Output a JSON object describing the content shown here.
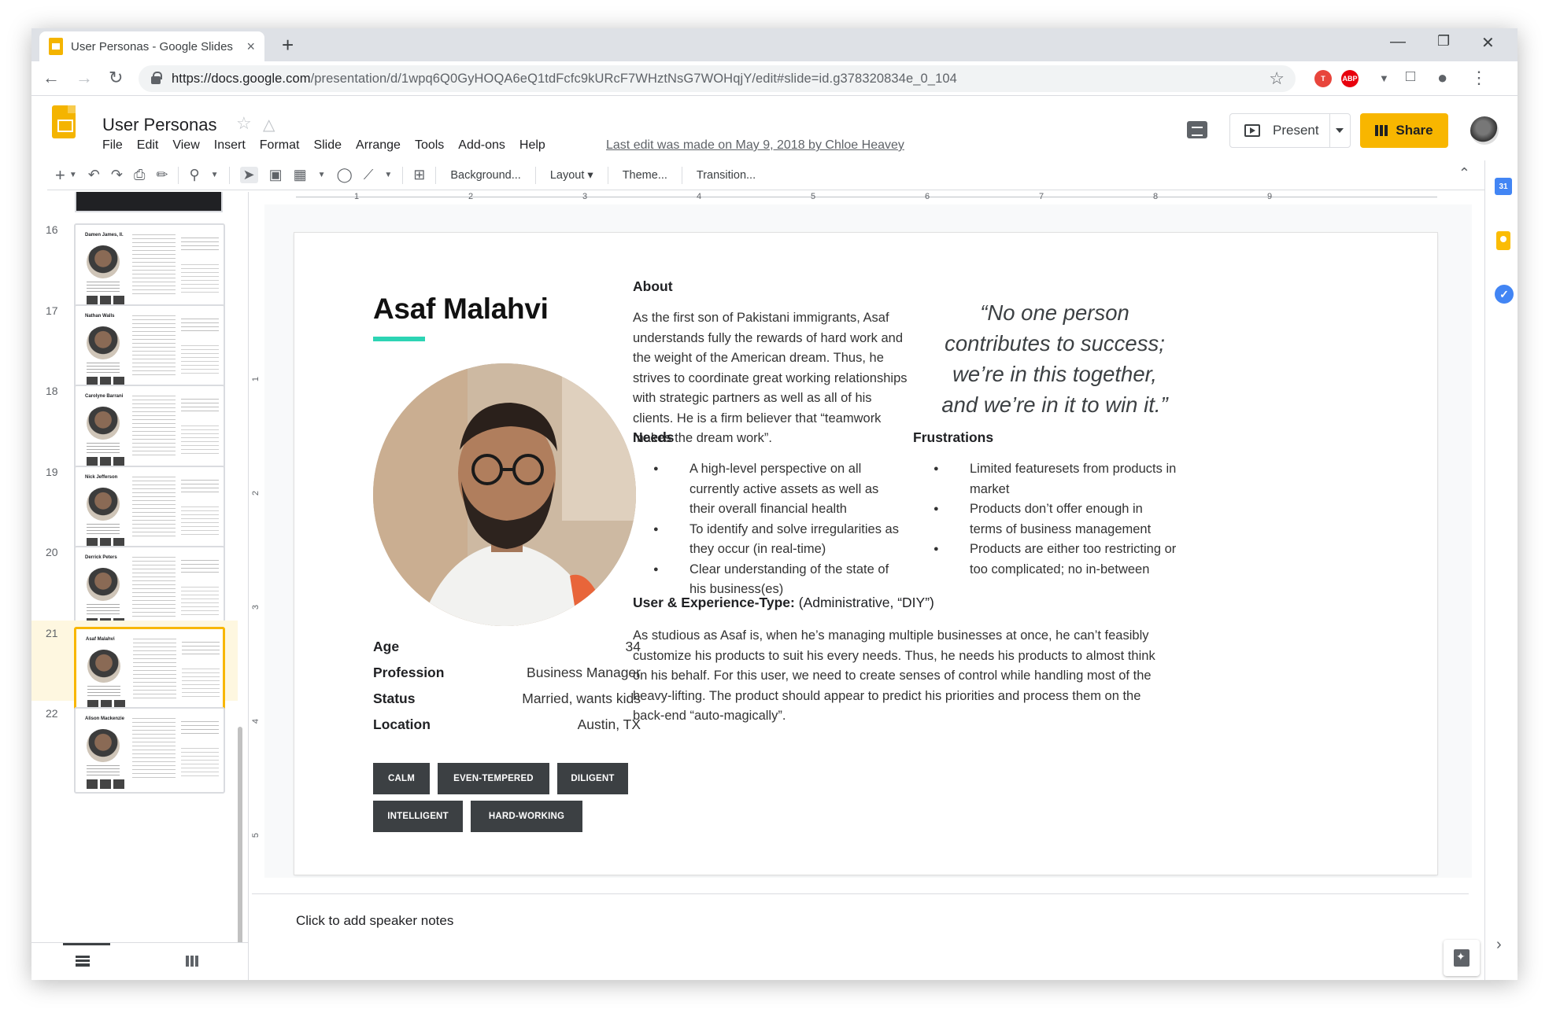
{
  "browser": {
    "tab_title": "User Personas - Google Slides",
    "tab_close": "×",
    "new_tab": "+",
    "url_host": "https://docs.google.com",
    "url_path": "/presentation/d/1wpq6Q0GyHOQA6eQ1tdFcfc9kURcF7WHztNsG7WOHqjY/edit#slide=id.g378320834e_0_104",
    "ext_abp": "ABP",
    "ext_t": "T"
  },
  "header": {
    "title": "User Personas",
    "menu": [
      "File",
      "Edit",
      "View",
      "Insert",
      "Format",
      "Slide",
      "Arrange",
      "Tools",
      "Add-ons",
      "Help"
    ],
    "last_edit": "Last edit was made on May 9, 2018 by Chloe Heavey",
    "present_label": "Present",
    "share_label": "Share"
  },
  "toolbar": {
    "background": "Background...",
    "layout": "Layout",
    "theme": "Theme...",
    "transition": "Transition..."
  },
  "filmstrip": {
    "slides": [
      {
        "num": "16",
        "name": "Damen James, II."
      },
      {
        "num": "17",
        "name": "Nathan Walls"
      },
      {
        "num": "18",
        "name": "Carolyne Barrani"
      },
      {
        "num": "19",
        "name": "Nick Jefferson"
      },
      {
        "num": "20",
        "name": "Derrick Peters"
      },
      {
        "num": "21",
        "name": "Asaf Malahvi"
      },
      {
        "num": "22",
        "name": "Alison Mackenzie"
      }
    ],
    "active_index": 5
  },
  "ruler": {
    "h": [
      "1",
      "2",
      "3",
      "4",
      "5",
      "6",
      "7",
      "8",
      "9"
    ],
    "v": [
      "1",
      "2",
      "3",
      "4",
      "5"
    ]
  },
  "slide": {
    "name": "Asaf Malahvi",
    "stats": [
      {
        "label": "Age",
        "value": "34"
      },
      {
        "label": "Profession",
        "value": "Business Manager"
      },
      {
        "label": "Status",
        "value": "Married, wants kids"
      },
      {
        "label": "Location",
        "value": "Austin, TX"
      }
    ],
    "tags": [
      "CALM",
      "EVEN-TEMPERED",
      "DILIGENT",
      "INTELLIGENT",
      "HARD-WORKING"
    ],
    "about_heading": "About",
    "about_text": "As the first son of Pakistani immigrants, Asaf understands fully the rewards of hard work and the weight of the American dream. Thus, he strives to coordinate great working relationships with strategic partners as well as all of his clients. He is a firm believer that “teamwork makes the dream work”.",
    "quote": "“No one person contributes to success; we’re in this together, and we’re in it to win it.”",
    "needs_heading": "Needs",
    "needs": [
      "A high-level perspective on all currently active assets as well as their overall financial health",
      "To identify and solve irregularities as they occur (in real-time)",
      "Clear understanding of the state of his business(es)"
    ],
    "frustrations_heading": "Frustrations",
    "frustrations": [
      "Limited featuresets from products in market",
      "Products don’t offer enough in terms of business management",
      "Products are either too restricting or too complicated; no in-between"
    ],
    "ux_label": "User & Experience-Type:",
    "ux_value": "(Administrative, “DIY”)",
    "ux_text": "As studious as Asaf is, when he’s managing multiple businesses at once, he can’t feasibly customize his products to suit his every needs. Thus, he needs his products to almost think on his behalf. For this user, we need to create senses of control while handling most of the heavy-lifting. The product should appear to predict his priorities and process them on the back-end “auto-magically”."
  },
  "notes": {
    "placeholder": "Click to add speaker notes"
  },
  "sidepanel": {
    "calendar_day": "31",
    "tasks_glyph": "✓"
  },
  "colors": {
    "accent_teal": "#2dd4b4",
    "share_yellow": "#f8b600",
    "tag_dark": "#3c4043",
    "active_slide_border": "#f8b600"
  }
}
